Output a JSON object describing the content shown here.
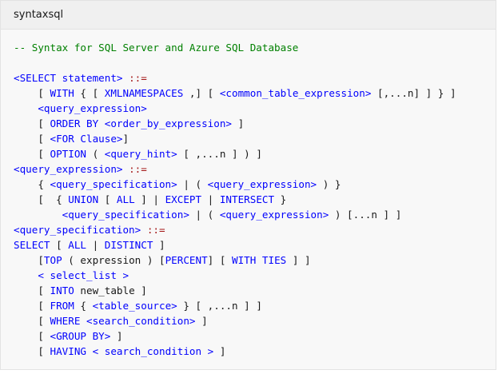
{
  "colors": {
    "comment": "#008000",
    "keyword": "#0101fd",
    "operator": "#a31515",
    "plain": "#171717",
    "header_bg": "#f0f0f0",
    "code_bg": "#f8f8f8"
  },
  "code_block": {
    "language_label": "syntaxsql",
    "lines": [
      [
        {
          "t": "c",
          "s": "-- Syntax for SQL Server and Azure SQL Database"
        }
      ],
      [
        {
          "t": "p",
          "s": ""
        }
      ],
      [
        {
          "t": "k",
          "s": "<SELECT statement>"
        },
        {
          "t": "p",
          "s": " "
        },
        {
          "t": "o",
          "s": "::="
        }
      ],
      [
        {
          "t": "p",
          "s": "    [ "
        },
        {
          "t": "k",
          "s": "WITH"
        },
        {
          "t": "p",
          "s": " { [ "
        },
        {
          "t": "k",
          "s": "XMLNAMESPACES"
        },
        {
          "t": "p",
          "s": " ,] [ "
        },
        {
          "t": "k",
          "s": "<common_table_expression>"
        },
        {
          "t": "p",
          "s": " [,...n] ] } ]"
        }
      ],
      [
        {
          "t": "p",
          "s": "    "
        },
        {
          "t": "k",
          "s": "<query_expression>"
        }
      ],
      [
        {
          "t": "p",
          "s": "    [ "
        },
        {
          "t": "k",
          "s": "ORDER BY"
        },
        {
          "t": "p",
          "s": " "
        },
        {
          "t": "k",
          "s": "<order_by_expression>"
        },
        {
          "t": "p",
          "s": " ]"
        }
      ],
      [
        {
          "t": "p",
          "s": "    [ "
        },
        {
          "t": "k",
          "s": "<FOR Clause>"
        },
        {
          "t": "p",
          "s": "]"
        }
      ],
      [
        {
          "t": "p",
          "s": "    [ "
        },
        {
          "t": "k",
          "s": "OPTION"
        },
        {
          "t": "p",
          "s": " ( "
        },
        {
          "t": "k",
          "s": "<query_hint>"
        },
        {
          "t": "p",
          "s": " [ ,...n ] ) ]"
        }
      ],
      [
        {
          "t": "k",
          "s": "<query_expression>"
        },
        {
          "t": "p",
          "s": " "
        },
        {
          "t": "o",
          "s": "::="
        }
      ],
      [
        {
          "t": "p",
          "s": "    { "
        },
        {
          "t": "k",
          "s": "<query_specification>"
        },
        {
          "t": "p",
          "s": " | ( "
        },
        {
          "t": "k",
          "s": "<query_expression>"
        },
        {
          "t": "p",
          "s": " ) }"
        }
      ],
      [
        {
          "t": "p",
          "s": "    [  { "
        },
        {
          "t": "k",
          "s": "UNION"
        },
        {
          "t": "p",
          "s": " [ "
        },
        {
          "t": "k",
          "s": "ALL"
        },
        {
          "t": "p",
          "s": " ] | "
        },
        {
          "t": "k",
          "s": "EXCEPT"
        },
        {
          "t": "p",
          "s": " | "
        },
        {
          "t": "k",
          "s": "INTERSECT"
        },
        {
          "t": "p",
          "s": " }"
        }
      ],
      [
        {
          "t": "p",
          "s": "        "
        },
        {
          "t": "k",
          "s": "<query_specification>"
        },
        {
          "t": "p",
          "s": " | ( "
        },
        {
          "t": "k",
          "s": "<query_expression>"
        },
        {
          "t": "p",
          "s": " ) [...n ] ]"
        }
      ],
      [
        {
          "t": "k",
          "s": "<query_specification>"
        },
        {
          "t": "p",
          "s": " "
        },
        {
          "t": "o",
          "s": "::="
        }
      ],
      [
        {
          "t": "k",
          "s": "SELECT"
        },
        {
          "t": "p",
          "s": " [ "
        },
        {
          "t": "k",
          "s": "ALL"
        },
        {
          "t": "p",
          "s": " | "
        },
        {
          "t": "k",
          "s": "DISTINCT"
        },
        {
          "t": "p",
          "s": " ]"
        }
      ],
      [
        {
          "t": "p",
          "s": "    ["
        },
        {
          "t": "k",
          "s": "TOP"
        },
        {
          "t": "p",
          "s": " ( expression ) ["
        },
        {
          "t": "k",
          "s": "PERCENT"
        },
        {
          "t": "p",
          "s": "] [ "
        },
        {
          "t": "k",
          "s": "WITH TIES"
        },
        {
          "t": "p",
          "s": " ] ]"
        }
      ],
      [
        {
          "t": "p",
          "s": "    "
        },
        {
          "t": "k",
          "s": "< select_list >"
        }
      ],
      [
        {
          "t": "p",
          "s": "    [ "
        },
        {
          "t": "k",
          "s": "INTO"
        },
        {
          "t": "p",
          "s": " new_table ]"
        }
      ],
      [
        {
          "t": "p",
          "s": "    [ "
        },
        {
          "t": "k",
          "s": "FROM"
        },
        {
          "t": "p",
          "s": " { "
        },
        {
          "t": "k",
          "s": "<table_source>"
        },
        {
          "t": "p",
          "s": " } [ ,...n ] ]"
        }
      ],
      [
        {
          "t": "p",
          "s": "    [ "
        },
        {
          "t": "k",
          "s": "WHERE"
        },
        {
          "t": "p",
          "s": " "
        },
        {
          "t": "k",
          "s": "<search_condition>"
        },
        {
          "t": "p",
          "s": " ]"
        }
      ],
      [
        {
          "t": "p",
          "s": "    [ "
        },
        {
          "t": "k",
          "s": "<GROUP BY>"
        },
        {
          "t": "p",
          "s": " ]"
        }
      ],
      [
        {
          "t": "p",
          "s": "    [ "
        },
        {
          "t": "k",
          "s": "HAVING"
        },
        {
          "t": "p",
          "s": " "
        },
        {
          "t": "k",
          "s": "< search_condition >"
        },
        {
          "t": "p",
          "s": " ]"
        }
      ]
    ]
  }
}
